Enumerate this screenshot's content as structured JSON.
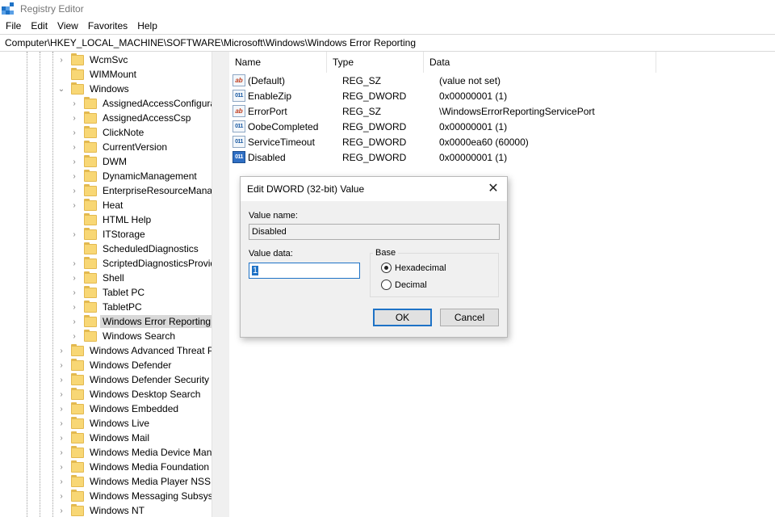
{
  "window": {
    "title": "Registry Editor"
  },
  "menu": [
    "File",
    "Edit",
    "View",
    "Favorites",
    "Help"
  ],
  "address": "Computer\\HKEY_LOCAL_MACHINE\\SOFTWARE\\Microsoft\\Windows\\Windows Error Reporting",
  "tree": [
    {
      "label": "WcmSvc",
      "expander": "›",
      "indent": 1
    },
    {
      "label": "WIMMount",
      "expander": "",
      "indent": 1
    },
    {
      "label": "Windows",
      "expander": "⌄",
      "indent": 1
    },
    {
      "label": "AssignedAccessConfigura",
      "expander": "›",
      "indent": 2
    },
    {
      "label": "AssignedAccessCsp",
      "expander": "›",
      "indent": 2
    },
    {
      "label": "ClickNote",
      "expander": "›",
      "indent": 2
    },
    {
      "label": "CurrentVersion",
      "expander": "›",
      "indent": 2
    },
    {
      "label": "DWM",
      "expander": "›",
      "indent": 2
    },
    {
      "label": "DynamicManagement",
      "expander": "›",
      "indent": 2
    },
    {
      "label": "EnterpriseResourceManag",
      "expander": "›",
      "indent": 2
    },
    {
      "label": "Heat",
      "expander": "›",
      "indent": 2
    },
    {
      "label": "HTML Help",
      "expander": "",
      "indent": 2
    },
    {
      "label": "ITStorage",
      "expander": "›",
      "indent": 2
    },
    {
      "label": "ScheduledDiagnostics",
      "expander": "",
      "indent": 2
    },
    {
      "label": "ScriptedDiagnosticsProvid",
      "expander": "›",
      "indent": 2
    },
    {
      "label": "Shell",
      "expander": "›",
      "indent": 2
    },
    {
      "label": "Tablet PC",
      "expander": "›",
      "indent": 2
    },
    {
      "label": "TabletPC",
      "expander": "›",
      "indent": 2
    },
    {
      "label": "Windows Error Reporting",
      "expander": "›",
      "indent": 2,
      "selected": true
    },
    {
      "label": "Windows Search",
      "expander": "›",
      "indent": 2
    },
    {
      "label": "Windows Advanced Threat Pr",
      "expander": "›",
      "indent": 1
    },
    {
      "label": "Windows Defender",
      "expander": "›",
      "indent": 1
    },
    {
      "label": "Windows Defender Security C",
      "expander": "›",
      "indent": 1
    },
    {
      "label": "Windows Desktop Search",
      "expander": "›",
      "indent": 1
    },
    {
      "label": "Windows Embedded",
      "expander": "›",
      "indent": 1
    },
    {
      "label": "Windows Live",
      "expander": "›",
      "indent": 1
    },
    {
      "label": "Windows Mail",
      "expander": "›",
      "indent": 1
    },
    {
      "label": "Windows Media Device Mana",
      "expander": "›",
      "indent": 1
    },
    {
      "label": "Windows Media Foundation",
      "expander": "›",
      "indent": 1
    },
    {
      "label": "Windows Media Player NSS",
      "expander": "›",
      "indent": 1
    },
    {
      "label": "Windows Messaging Subsyste",
      "expander": "›",
      "indent": 1
    },
    {
      "label": "Windows NT",
      "expander": "›",
      "indent": 1
    }
  ],
  "columns": {
    "name": "Name",
    "type": "Type",
    "data": "Data"
  },
  "values": [
    {
      "icon": "string-value-icon",
      "kind": "sz",
      "glyph": "ab",
      "name": "(Default)",
      "type": "REG_SZ",
      "data": "(value not set)"
    },
    {
      "icon": "dword-value-icon",
      "kind": "dw",
      "glyph": "011",
      "name": "EnableZip",
      "type": "REG_DWORD",
      "data": "0x00000001 (1)"
    },
    {
      "icon": "string-value-icon",
      "kind": "sz",
      "glyph": "ab",
      "name": "ErrorPort",
      "type": "REG_SZ",
      "data": "\\WindowsErrorReportingServicePort"
    },
    {
      "icon": "dword-value-icon",
      "kind": "dw",
      "glyph": "011",
      "name": "OobeCompleted",
      "type": "REG_DWORD",
      "data": "0x00000001 (1)"
    },
    {
      "icon": "dword-value-icon",
      "kind": "dw",
      "glyph": "011",
      "name": "ServiceTimeout",
      "type": "REG_DWORD",
      "data": "0x0000ea60 (60000)"
    },
    {
      "icon": "dword-value-icon",
      "kind": "dw sel",
      "glyph": "011",
      "name": "Disabled",
      "type": "REG_DWORD",
      "data": "0x00000001 (1)"
    }
  ],
  "dialog": {
    "title": "Edit DWORD (32-bit) Value",
    "close": "✕",
    "value_name_label": "Value name:",
    "value_name": "Disabled",
    "value_data_label": "Value data:",
    "value_data": "1",
    "base_label": "Base",
    "hex_label": "Hexadecimal",
    "dec_label": "Decimal",
    "selected_base": "Hexadecimal",
    "ok": "OK",
    "cancel": "Cancel"
  }
}
